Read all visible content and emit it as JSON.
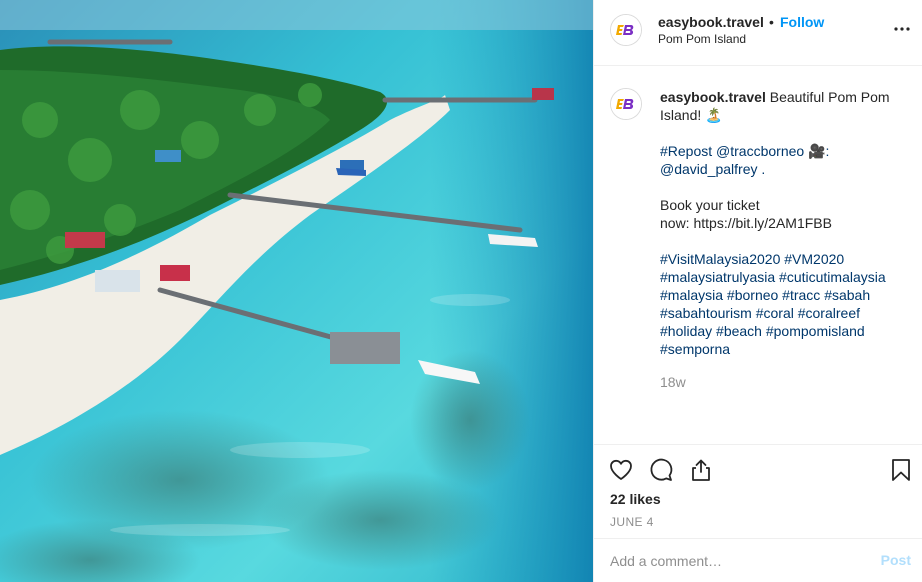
{
  "photo": {
    "subject": "aerial view of island with white beach, palm trees, wooden jetties and turquoise reef water",
    "colors": {
      "water_deep": "#1aa7c4",
      "water_light": "#52d6de",
      "sand": "#efece4",
      "jungle": "#1f6b2a"
    }
  },
  "header": {
    "username": "easybook.travel",
    "separator": "•",
    "follow_label": "Follow",
    "location": "Pom Pom Island",
    "avatar_letters": "EB"
  },
  "caption": {
    "username": "easybook.travel",
    "lines": [
      "Beautiful Pom Pom",
      "Island! 🏝️"
    ],
    "repost": "#Repost @traccborneo 🎥:",
    "repost_credit": "@david_palfrey .",
    "ticket_line1": "Book your ticket",
    "ticket_line2": "now: https://bit.ly/2AM1FBB",
    "hashtags": [
      "#VisitMalaysia2020 #VM2020",
      "#malaysiatrulyasia #cuticutimalaysia",
      "#malaysia #borneo #tracc #sabah",
      "#sabahtourism #coral #coralreef",
      "#holiday #beach #pompomisland",
      "#semporna"
    ],
    "age": "18w"
  },
  "actions": {
    "likes": "22 likes",
    "date": "JUNE 4"
  },
  "comment": {
    "placeholder": "Add a comment…",
    "post_label": "Post"
  },
  "icons": [
    "heart-icon",
    "comment-icon",
    "share-icon",
    "bookmark-icon",
    "more-options-icon"
  ],
  "accent": {
    "link_blue": "#0095f6",
    "hashtag_blue": "#00376b",
    "post_disabled": "#b2dffc"
  }
}
